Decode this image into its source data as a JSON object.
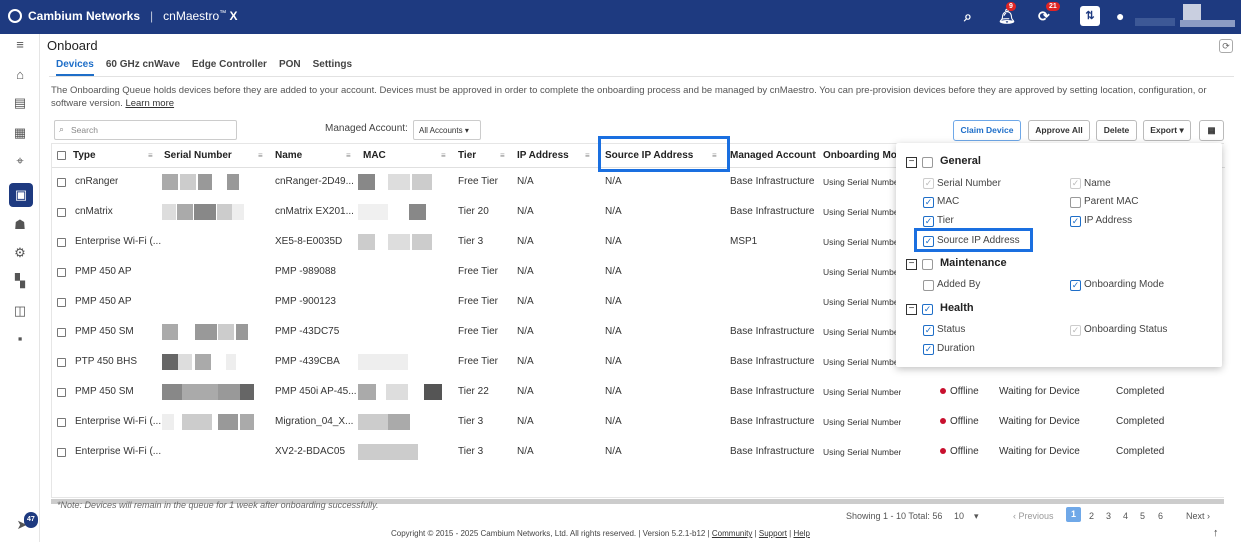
{
  "topbar": {
    "brand": "Cambium Networks",
    "product": "cnMaestro",
    "product_tm": "™",
    "product_x": "X",
    "bell_count": "9",
    "sync_count": "21"
  },
  "page": {
    "title": "Onboard"
  },
  "tabs": [
    "Devices",
    "60 GHz cnWave",
    "Edge Controller",
    "PON",
    "Settings"
  ],
  "info": {
    "text": "The Onboarding Queue holds devices before they are added to your account. Devices must be approved in order to complete the onboarding process and be managed by cnMaestro. You can pre-provision devices before they are approved by setting location, configuration, or software version.",
    "link": "Learn more"
  },
  "toolbar": {
    "search_placeholder": "Search",
    "managed_account_label": "Managed Account:",
    "managed_account_value": "All Accounts",
    "claim": "Claim Device",
    "approve": "Approve All",
    "delete": "Delete",
    "export": "Export"
  },
  "columns": {
    "type": "Type",
    "serial": "Serial Number",
    "name": "Name",
    "mac": "MAC",
    "tier": "Tier",
    "ip": "IP Address",
    "source_ip": "Source IP Address",
    "managed_account": "Managed Account",
    "onboarding_mode": "Onboarding Mo"
  },
  "rows": [
    {
      "type": "cnRanger",
      "name": "cnRanger-2D49...",
      "tier": "Free Tier",
      "ip": "N/A",
      "source_ip": "N/A",
      "account": "Base Infrastructure",
      "mode": "Using Serial Numbe",
      "status": "",
      "duration": "",
      "result": ""
    },
    {
      "type": "cnMatrix",
      "name": "cnMatrix EX201...",
      "tier": "Tier 20",
      "ip": "N/A",
      "source_ip": "N/A",
      "account": "Base Infrastructure",
      "mode": "Using Serial Numbe",
      "status": "",
      "duration": "",
      "result": ""
    },
    {
      "type": "Enterprise Wi-Fi (...",
      "name": "XE5-8-E0035D",
      "tier": "Tier 3",
      "ip": "N/A",
      "source_ip": "N/A",
      "account": "MSP1",
      "mode": "Using Serial Numbe",
      "status": "",
      "duration": "",
      "result": ""
    },
    {
      "type": "PMP 450 AP",
      "name": "PMP -989088",
      "tier": "Free Tier",
      "ip": "N/A",
      "source_ip": "N/A",
      "account": "",
      "mode": "Using Serial Numbe",
      "status": "",
      "duration": "",
      "result": ""
    },
    {
      "type": "PMP 450 AP",
      "name": "PMP -900123",
      "tier": "Free Tier",
      "ip": "N/A",
      "source_ip": "N/A",
      "account": "",
      "mode": "Using Serial Numbe",
      "status": "",
      "duration": "",
      "result": ""
    },
    {
      "type": "PMP 450 SM",
      "name": "PMP -43DC75",
      "tier": "Free Tier",
      "ip": "N/A",
      "source_ip": "N/A",
      "account": "Base Infrastructure",
      "mode": "Using Serial Numbe",
      "status": "",
      "duration": "",
      "result": ""
    },
    {
      "type": "PTP 450 BHS",
      "name": "PMP -439CBA",
      "tier": "Free Tier",
      "ip": "N/A",
      "source_ip": "N/A",
      "account": "Base Infrastructure",
      "mode": "Using Serial Numbe",
      "status": "",
      "duration": "",
      "result": ""
    },
    {
      "type": "PMP 450 SM",
      "name": "PMP 450i AP-45...",
      "tier": "Tier 22",
      "ip": "N/A",
      "source_ip": "N/A",
      "account": "Base Infrastructure",
      "mode": "Using Serial Number",
      "status": "Offline",
      "duration": "Waiting for Device",
      "result": "Completed"
    },
    {
      "type": "Enterprise Wi-Fi (...",
      "name": "Migration_04_X...",
      "tier": "Tier 3",
      "ip": "N/A",
      "source_ip": "N/A",
      "account": "Base Infrastructure",
      "mode": "Using Serial Number",
      "status": "Offline",
      "duration": "Waiting for Device",
      "result": "Completed"
    },
    {
      "type": "Enterprise Wi-Fi (...",
      "name": "XV2-2-BDAC05",
      "tier": "Tier 3",
      "ip": "N/A",
      "source_ip": "N/A",
      "account": "Base Infrastructure",
      "mode": "Using Serial Number",
      "status": "Offline",
      "duration": "Waiting for Device",
      "result": "Completed"
    }
  ],
  "panel": {
    "general": "General",
    "serial": "Serial Number",
    "name": "Name",
    "mac": "MAC",
    "parent_mac": "Parent MAC",
    "tier": "Tier",
    "ip": "IP Address",
    "source_ip": "Source IP Address",
    "maintenance": "Maintenance",
    "added_by": "Added By",
    "onboarding_mode": "Onboarding Mode",
    "health": "Health",
    "status": "Status",
    "onboarding_status": "Onboarding Status",
    "duration": "Duration"
  },
  "pager": {
    "showing": "Showing 1 - 10 Total: 56",
    "per_page": "10",
    "prev": "Previous",
    "pages": [
      "1",
      "2",
      "3",
      "4",
      "5",
      "6"
    ],
    "next": "Next"
  },
  "note": "*Note: Devices will remain in the queue for 1 week after onboarding successfully.",
  "footer": {
    "copyright": "Copyright © 2015 - 2025 Cambium Networks, Ltd. All rights reserved.",
    "version": "Version 5.2.1-b12",
    "community": "Community",
    "support": "Support",
    "help": "Help"
  },
  "sidebar_badge": "47",
  "colors": {
    "brand": "#1e3a80",
    "accent": "#1e6ec8",
    "highlight": "#1a6fe0",
    "offline": "#c8102e"
  }
}
